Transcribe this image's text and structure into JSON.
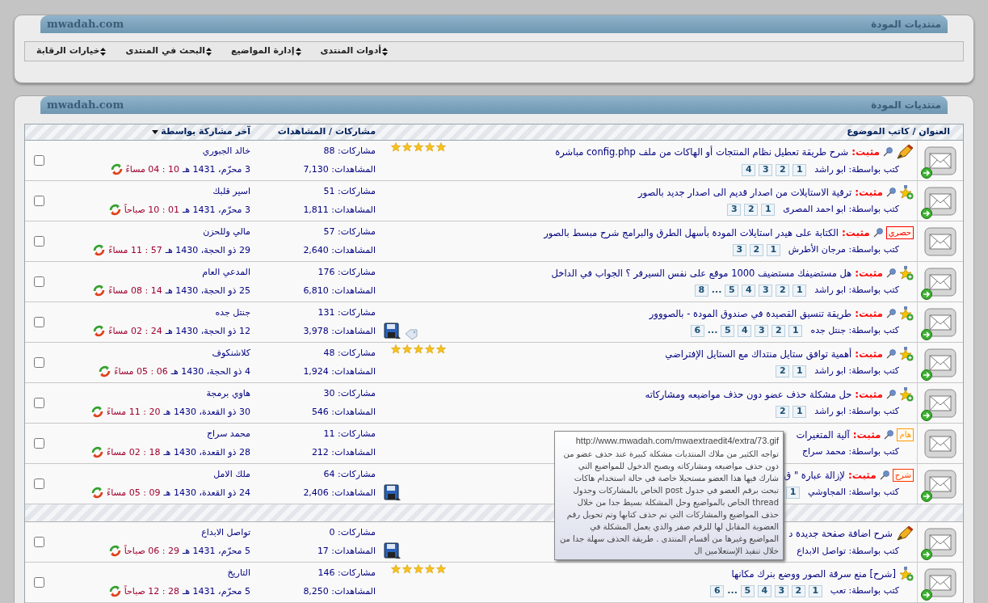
{
  "top_panel": {
    "title": "منتديات المودة",
    "site": "mwadah.com",
    "menu": [
      "أدوات المنتدى",
      "إدارة المواضيع",
      "البحث في المنتدى",
      "خيارات الرقابة"
    ]
  },
  "forum_panel": {
    "title": "منتديات المودة",
    "site": "mwadah.com"
  },
  "table": {
    "columns": [
      "العنوان / كاتب الموضوع",
      "مشاركات / المشاهدات",
      "آخر مشاركة بواسطة"
    ],
    "sections": [
      {
        "rows": [
          {
            "new": true,
            "kind": "pen",
            "pinned": true,
            "prefix": "مثبت:",
            "title": "شرح طريقة تعطيل نظام المنتجات أو الهاكات من ملف config.php مباشرة",
            "byline": "كتب بواسطة: ابو راشد",
            "pages": [
              {
                "kind": "page",
                "label": "1"
              },
              {
                "kind": "page",
                "label": "2"
              },
              {
                "kind": "page",
                "label": "3"
              },
              {
                "kind": "page",
                "label": "4"
              }
            ],
            "stars": 5,
            "attachment": false,
            "tagged": false,
            "posts": "مشاركات: 88",
            "views": "المشاهدات: 7,130",
            "last_poster": "خالد الجبوري",
            "date": "3 محرّم، 1431 هـ",
            "time": "10 : 04 مساءً",
            "checked": false
          },
          {
            "new": true,
            "kind": "star",
            "pinned": true,
            "prefix": "مثبت:",
            "title": "ترقية الاستايلات من اصدار قديم الى اصدار جديد بالصور",
            "byline": "كتب بواسطة: ابو احمد المصرى",
            "pages": [
              {
                "kind": "page",
                "label": "1"
              },
              {
                "kind": "page",
                "label": "2"
              },
              {
                "kind": "page",
                "label": "3"
              }
            ],
            "attachment": false,
            "tagged": false,
            "posts": "مشاركات: 51",
            "views": "المشاهدات: 1,811",
            "last_poster": "اسير قلبك",
            "date": "3 محرّم، 1431 هـ",
            "time": "01 : 10 صباحاً",
            "checked": false
          },
          {
            "new": false,
            "kind": "badge",
            "badge": {
              "text": "حصري",
              "color": "#ff0000"
            },
            "pinned": true,
            "prefix": "مثبت:",
            "title": "الكتابة على هيدر استايلات المودة بأسهل الطرق والبرامج شرح مبسط بالصور",
            "byline": "كتب بواسطة: مرجان الأطرش",
            "pages": [
              {
                "kind": "page",
                "label": "1"
              },
              {
                "kind": "page",
                "label": "2"
              },
              {
                "kind": "page",
                "label": "3"
              }
            ],
            "attachment": false,
            "tagged": false,
            "posts": "مشاركات: 57",
            "views": "المشاهدات: 2,640",
            "last_poster": "مالي وللحزن",
            "date": "29 ذو الحجة، 1430 هـ",
            "time": "57 : 11 مساءً",
            "checked": false
          },
          {
            "new": true,
            "kind": "star",
            "pinned": true,
            "prefix": "مثبت:",
            "title": "هل مستضيفك مستضيف 1000 موقع على نفس السيرفر ؟ الجواب في الداخل",
            "byline": "كتب بواسطة: ابو راشد",
            "pages": [
              {
                "kind": "page",
                "label": "1"
              },
              {
                "kind": "page",
                "label": "2"
              },
              {
                "kind": "page",
                "label": "3"
              },
              {
                "kind": "page",
                "label": "4"
              },
              {
                "kind": "page",
                "label": "5"
              },
              {
                "kind": "gap",
                "label": "..."
              },
              {
                "kind": "page",
                "label": "8"
              }
            ],
            "attachment": false,
            "tagged": false,
            "posts": "مشاركات: 176",
            "views": "المشاهدات: 6,810",
            "last_poster": "المدعي العام",
            "date": "25 ذو الحجة، 1430 هـ",
            "time": "14 : 08 مساءً",
            "checked": false
          },
          {
            "new": true,
            "kind": "star",
            "pinned": true,
            "prefix": "مثبت:",
            "title": "طريقة تنسيق القصيدة في صندوق المودة - بالصووور",
            "byline": "كتب بواسطة: جنتل جده",
            "pages": [
              {
                "kind": "page",
                "label": "1"
              },
              {
                "kind": "page",
                "label": "2"
              },
              {
                "kind": "page",
                "label": "3"
              },
              {
                "kind": "page",
                "label": "4"
              },
              {
                "kind": "page",
                "label": "5"
              },
              {
                "kind": "gap",
                "label": "..."
              },
              {
                "kind": "page",
                "label": "6"
              }
            ],
            "attachment": true,
            "tagged": true,
            "posts": "مشاركات: 131",
            "views": "المشاهدات: 3,978",
            "last_poster": "جنتل جده",
            "date": "12 ذو الحجة، 1430 هـ",
            "time": "24 : 02 مساءً",
            "checked": false
          },
          {
            "new": true,
            "kind": "star",
            "pinned": true,
            "prefix": "مثبت:",
            "title": "أهمية توافق ستايل منتداك مع الستايل الإفتراضي",
            "byline": "كتب بواسطة: ابو راشد",
            "pages": [
              {
                "kind": "page",
                "label": "1"
              },
              {
                "kind": "page",
                "label": "2"
              }
            ],
            "stars": 5,
            "attachment": false,
            "tagged": false,
            "posts": "مشاركات: 48",
            "views": "المشاهدات: 1,924",
            "last_poster": "كلاشنكوف",
            "date": "4 ذو الحجة، 1430 هـ",
            "time": "06 : 05 مساءً",
            "checked": false
          },
          {
            "new": true,
            "kind": "star",
            "pinned": true,
            "prefix": "مثبت:",
            "title": "حل مشكلة حذف عضو دون حذف مواضيعه ومشاركاته",
            "byline": "كتب بواسطة: ابو راشد",
            "pages": [
              {
                "kind": "page",
                "label": "1"
              },
              {
                "kind": "page",
                "label": "2"
              }
            ],
            "attachment": false,
            "tagged": false,
            "posts": "مشاركات: 30",
            "views": "المشاهدات: 546",
            "last_poster": "هاوي برمجة",
            "date": "30 ذو القعدة، 1430 هـ",
            "time": "20 : 11 مساءً",
            "checked": false
          },
          {
            "new": false,
            "kind": "badge",
            "badge": {
              "text": "هام",
              "color": "#ff9900"
            },
            "pinned": true,
            "prefix": "مثبت:",
            "title": "آلية المتغيرات",
            "byline": "كتب بواسطة: محمد سراج",
            "pages": [],
            "attachment": false,
            "tagged": false,
            "posts": "مشاركات: 11",
            "views": "المشاهدات: 212",
            "last_poster": "محمد سراج",
            "date": "28 ذو القعدة، 1430 هـ",
            "time": "18 : 02 مساءً",
            "checked": false
          },
          {
            "new": true,
            "kind": "badge",
            "badge": {
              "text": "شرح",
              "color": "#ff3300"
            },
            "pinned": true,
            "prefix": "مثبت:",
            "title": "لإزالة عبارة \" ق",
            "byline": "كتب بواسطة: المجاوشي",
            "pages": [
              {
                "kind": "page",
                "label": "1"
              }
            ],
            "attachment": true,
            "tagged": false,
            "posts": "مشاركات: 64",
            "views": "المشاهدات: 2,406",
            "last_poster": "ملك الامل",
            "date": "24 ذو القعدة، 1430 هـ",
            "time": "09 : 05 مساءً",
            "checked": false
          }
        ]
      },
      {
        "rows": [
          {
            "new": true,
            "kind": "pen",
            "pinned": false,
            "title": "شرح اضافة صفحة جديدة د",
            "byline": "كتب بواسطة: تواصل الابداع",
            "pages": [],
            "attachment": true,
            "tagged": false,
            "posts": "مشاركات: 0",
            "views": "المشاهدات: 17",
            "last_poster": "تواصل الابداع",
            "date": "5 محرّم، 1431 هـ",
            "time": "29 : 06 صباحاً",
            "checked": false
          },
          {
            "new": true,
            "kind": "star",
            "pinned": false,
            "title": "[شرح] منع سرقة الصور ووضع بنرك مكانها",
            "byline": "كتب بواسطة: تعب",
            "pages": [
              {
                "kind": "page",
                "label": "1"
              },
              {
                "kind": "page",
                "label": "2"
              },
              {
                "kind": "page",
                "label": "3"
              },
              {
                "kind": "page",
                "label": "4"
              },
              {
                "kind": "page",
                "label": "5"
              },
              {
                "kind": "gap",
                "label": "..."
              },
              {
                "kind": "page",
                "label": "6"
              }
            ],
            "stars": 5,
            "attachment": false,
            "tagged": false,
            "posts": "مشاركات: 146",
            "views": "المشاهدات: 8,250",
            "last_poster": "التاريخ",
            "date": "5 محرّم، 1431 هـ",
            "time": "28 : 12 صباحاً",
            "checked": false
          }
        ]
      }
    ]
  },
  "tooltip": {
    "url": "http://www.mwadah.com/mwaextraedit4/extra/73.gif",
    "text": "تواجه الكثير من ملاك المنتديات مشكلة كبيرة عند حذف عضو من دون حذف مواضيعه ومشاركاته ويصبح الدخول للمواضيع التي شارك فيها هذا العضو مستحيلا خاصة في حالة استخدام هاكات تبحث برقم العضو في جدول post الخاص بالمشاركات وجدول thread الخاص بالمواضيع وحل المشكلة بسيط جدا من خلال حذف المواضيع والمشاركات التي تم حذف كتابها وتم تحويل رقم العضوية المقابل لها للرقم صفر والذي يعمل المشكلة في المواضيع وغيرها من أقسام المنتدى . طريقة الحذف سهلة جدا من خلال تنفيذ الإستعلامين ال"
  }
}
